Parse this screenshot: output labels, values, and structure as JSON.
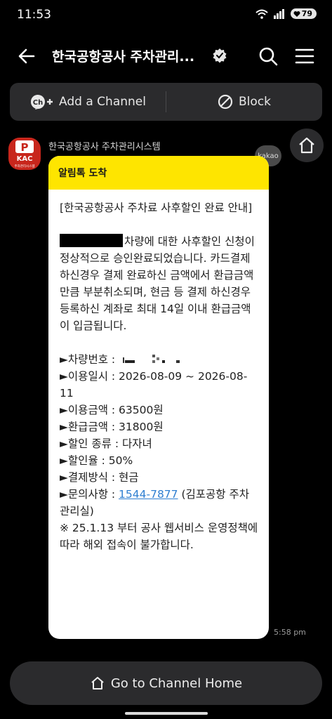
{
  "status": {
    "time": "11:53",
    "battery": "79"
  },
  "header": {
    "title": "한국공항공사 주차관리...",
    "back_icon": "back-arrow-icon",
    "search_icon": "search-icon",
    "menu_icon": "hamburger-menu-icon"
  },
  "actions": {
    "add_channel": "Add a Channel",
    "add_channel_icon_text": "Ch",
    "block": "Block"
  },
  "channel": {
    "sender": "한국공항공사 주차관리시스템",
    "avatar_logo": "KAC",
    "avatar_caption": "주차관리시스템",
    "kakao_badge": "kakao"
  },
  "message": {
    "header": "알림톡 도착",
    "title": "[한국공항공사 주차료 사후할인 완료 안내]",
    "intro": "차량에 대한 사후할인 신청이 정상적으로 승인완료되었습니다. 카드결제 하신경우 결제 완료하신 금액에서 환급금액만큼 부분취소되며, 현금 등 결제 하신경우 등록하신 계좌로 최대 14일 이내 환급금액이 입금됩니다.",
    "plate_label": "►차량번호 : ",
    "usage_period": "►이용일시 : 2026-08-09 ~ 2026-08-11",
    "usage_amount": "►이용금액 : 63500원",
    "refund_amount": "►환급금액 : 31800원",
    "discount_type": "►할인 종류 : 다자녀",
    "discount_rate": "►할인율 : 50%",
    "payment_method": "►결제방식 : 현금",
    "inquiry_label": "►문의사항 : ",
    "inquiry_phone": "1544-7877",
    "inquiry_place": " (김포공항 주차관리실)",
    "notice": "※ 25.1.13 부터 공사 웹서비스 운영정책에 따라 해외 접속이 불가합니다.",
    "time": "5:58 pm"
  },
  "footer": {
    "go_home": "Go to Channel Home"
  }
}
